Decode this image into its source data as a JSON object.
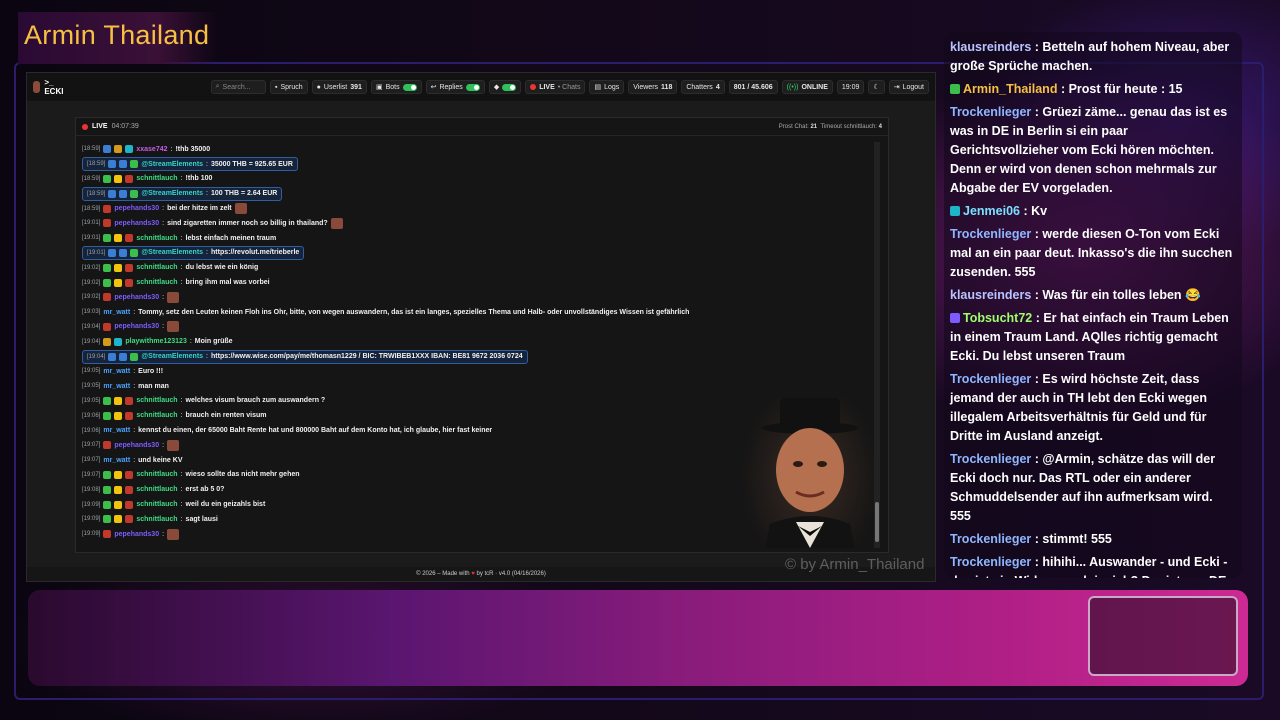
{
  "stream": {
    "title": "Armin Thailand",
    "watermark": "© by Armin_Thailand"
  },
  "topbar": {
    "brand": ">_ ECKI",
    "search_placeholder": "Search...",
    "spruch": "Spruch",
    "userlist_label": "Userlist",
    "userlist_count": "391",
    "bots": "Bots",
    "replies": "Replies",
    "live": "LIVE",
    "chats": "• Chats",
    "logs": "Logs",
    "viewers_label": "Viewers",
    "viewers_count": "118",
    "chatters_label": "Chatters",
    "chatters_count": "4",
    "ratio": "801 / 45.606",
    "online": "ONLINE",
    "clock": "19:09",
    "logout": "Logout"
  },
  "panel": {
    "live": "LIVE",
    "time": "04:07:39",
    "prost_label": "Prost Chat:",
    "prost_value": "21",
    "timeout_label": "Timeout schnittlauch:",
    "timeout_value": "4"
  },
  "chat": [
    {
      "ts": "[18:59]",
      "user": "xxase742",
      "color": "#c45ee8",
      "text": "!thb 35000",
      "bubble": false,
      "badges": [
        "b-blue",
        "b-gold",
        "b-cyan"
      ]
    },
    {
      "ts": "[18:59]",
      "user": "@StreamElements",
      "color": "#33d4c9",
      "text": "35000 THB = 925.65 EUR",
      "bubble": true,
      "badges": [
        "b-blue",
        "b-blue",
        "b-green"
      ]
    },
    {
      "ts": "[18:59]",
      "user": "schnittlauch",
      "color": "#3ddc84",
      "text": "!thb 100",
      "bubble": false,
      "badges": [
        "b-green",
        "b-yellow",
        "b-red"
      ]
    },
    {
      "ts": "[18:59]",
      "user": "@StreamElements",
      "color": "#33d4c9",
      "text": "100 THB = 2.64 EUR",
      "bubble": true,
      "badges": [
        "b-blue",
        "b-blue",
        "b-green"
      ]
    },
    {
      "ts": "[18:59]",
      "user": "pepehands30",
      "color": "#7d5cff",
      "text": "bei der hitze im zelt",
      "bubble": false,
      "badges": [
        "b-red"
      ],
      "emote": true
    },
    {
      "ts": "[19:01]",
      "user": "pepehands30",
      "color": "#7d5cff",
      "text": "sind zigaretten immer noch so billig in thailand?",
      "bubble": false,
      "badges": [
        "b-red"
      ],
      "emote": true
    },
    {
      "ts": "[19:01]",
      "user": "schnittlauch",
      "color": "#3ddc84",
      "text": "lebst einfach meinen traum",
      "bubble": false,
      "badges": [
        "b-green",
        "b-yellow",
        "b-red"
      ]
    },
    {
      "ts": "[19:01]",
      "user": "@StreamElements",
      "color": "#33d4c9",
      "text": "https://revolut.me/trieberle",
      "bubble": true,
      "badges": [
        "b-blue",
        "b-blue",
        "b-green"
      ]
    },
    {
      "ts": "[19:02]",
      "user": "schnittlauch",
      "color": "#3ddc84",
      "text": "du lebst wie ein könig",
      "bubble": false,
      "badges": [
        "b-green",
        "b-yellow",
        "b-red"
      ]
    },
    {
      "ts": "[19:02]",
      "user": "schnittlauch",
      "color": "#3ddc84",
      "text": "bring ihm mal was vorbei",
      "bubble": false,
      "badges": [
        "b-green",
        "b-yellow",
        "b-red"
      ]
    },
    {
      "ts": "[19:02]",
      "user": "pepehands30",
      "color": "#7d5cff",
      "text": "",
      "bubble": false,
      "badges": [
        "b-red"
      ],
      "emote": true
    },
    {
      "ts": "[19:03]",
      "user": "mr_watt",
      "color": "#4aa3ff",
      "text": "Tommy, setz den Leuten keinen Floh ins Ohr, bitte, von wegen auswandern, das ist ein langes, spezielles Thema und Halb- oder unvollständiges Wissen ist gefährlich",
      "bubble": false,
      "badges": []
    },
    {
      "ts": "[19:04]",
      "user": "pepehands30",
      "color": "#7d5cff",
      "text": "",
      "bubble": false,
      "badges": [
        "b-red"
      ],
      "emote": true
    },
    {
      "ts": "[19:04]",
      "user": "playwithme123123",
      "color": "#3ddc84",
      "text": "Moin grüße",
      "bubble": false,
      "badges": [
        "b-gold",
        "b-cyan"
      ]
    },
    {
      "ts": "[19:04]",
      "user": "@StreamElements",
      "color": "#33d4c9",
      "text": "https://www.wise.com/pay/me/thomasn1229 / BIC: TRWIBEB1XXX IBAN: BE81 9672 2036 0724",
      "bubble": true,
      "badges": [
        "b-blue",
        "b-blue",
        "b-green"
      ]
    },
    {
      "ts": "[19:05]",
      "user": "mr_watt",
      "color": "#4aa3ff",
      "text": "Euro !!!",
      "bubble": false,
      "badges": []
    },
    {
      "ts": "[19:05]",
      "user": "mr_watt",
      "color": "#4aa3ff",
      "text": "man man",
      "bubble": false,
      "badges": []
    },
    {
      "ts": "[19:05]",
      "user": "schnittlauch",
      "color": "#3ddc84",
      "text": "welches visum brauch zum auswandern ?",
      "bubble": false,
      "badges": [
        "b-green",
        "b-yellow",
        "b-red"
      ]
    },
    {
      "ts": "[19:06]",
      "user": "schnittlauch",
      "color": "#3ddc84",
      "text": "brauch ein renten visum",
      "bubble": false,
      "badges": [
        "b-green",
        "b-yellow",
        "b-red"
      ]
    },
    {
      "ts": "[19:06]",
      "user": "mr_watt",
      "color": "#4aa3ff",
      "text": "kennst du einen, der 65000 Baht Rente hat und 800000 Baht auf dem Konto hat, ich glaube, hier fast keiner",
      "bubble": false,
      "badges": []
    },
    {
      "ts": "[19:07]",
      "user": "pepehands30",
      "color": "#7d5cff",
      "text": "",
      "bubble": false,
      "badges": [
        "b-red"
      ],
      "emote": true
    },
    {
      "ts": "[19:07]",
      "user": "mr_watt",
      "color": "#4aa3ff",
      "text": "und keine KV",
      "bubble": false,
      "badges": []
    },
    {
      "ts": "[19:07]",
      "user": "schnittlauch",
      "color": "#3ddc84",
      "text": "wieso sollte das nicht mehr gehen",
      "bubble": false,
      "badges": [
        "b-green",
        "b-yellow",
        "b-red"
      ]
    },
    {
      "ts": "[19:08]",
      "user": "schnittlauch",
      "color": "#3ddc84",
      "text": "erst ab 5 0?",
      "bubble": false,
      "badges": [
        "b-green",
        "b-yellow",
        "b-red"
      ]
    },
    {
      "ts": "[19:09]",
      "user": "schnittlauch",
      "color": "#3ddc84",
      "text": "weil du ein geizahls bist",
      "bubble": false,
      "badges": [
        "b-green",
        "b-yellow",
        "b-red"
      ]
    },
    {
      "ts": "[19:09]",
      "user": "schnittlauch",
      "color": "#3ddc84",
      "text": "sagt lausi",
      "bubble": false,
      "badges": [
        "b-green",
        "b-yellow",
        "b-red"
      ]
    },
    {
      "ts": "[19:09]",
      "user": "pepehands30",
      "color": "#7d5cff",
      "text": "",
      "bubble": false,
      "badges": [
        "b-red"
      ],
      "emote": true
    }
  ],
  "footer": {
    "pre": "© 2026 – Made with",
    "post": "by tcR · v4.0 (04/16/2026)"
  },
  "side_chat": [
    {
      "user": "klausreinders",
      "color": "#b9c4ff",
      "text": "Betteln auf hohem Niveau, aber große Sprüche machen.",
      "icon": ""
    },
    {
      "user": "Armin_Thailand",
      "color": "#f6c044",
      "text": "Prost für heute : 15",
      "icon": "#3bbf4a"
    },
    {
      "user": "Trockenlieger",
      "color": "#8fb7ff",
      "text": "Grüezi zäme... genau das ist es was in DE in Berlin si ein paar Gerichtsvollzieher vom Ecki hören möchten. Denn er wird von denen schon mehrmals zur Abgabe der EV vorgeladen.",
      "icon": ""
    },
    {
      "user": "Jenmei06",
      "color": "#7be0ff",
      "text": "Kv",
      "icon": "#1fb5c9"
    },
    {
      "user": "Trockenlieger",
      "color": "#8fb7ff",
      "text": "werde diesen O-Ton vom Ecki mal an ein paar deut. Inkasso's die ihn succhen zusenden. 555",
      "icon": ""
    },
    {
      "user": "klausreinders",
      "color": "#b9c4ff",
      "text": "Was für ein tolles leben 😂",
      "icon": ""
    },
    {
      "user": "Tobsucht72",
      "color": "#9cff6a",
      "text": "Er hat einfach ein Traum Leben in einem Traum Land. AQlles richtig gemacht Ecki. Du lebst unseren Traum",
      "icon": "#7d5cff"
    },
    {
      "user": "Trockenlieger",
      "color": "#8fb7ff",
      "text": "Es wird höchste Zeit, dass jemand der auch in TH lebt den Ecki wegen illegalem Arbeitsverhältnis für Geld und für Dritte im Ausland anzeigt.",
      "icon": ""
    },
    {
      "user": "Trockenlieger",
      "color": "#8fb7ff",
      "text": "@Armin, schätze das will der Ecki doch nur. Das RTL oder ein anderer Schmuddelsender auf ihn aufmerksam wird. 555",
      "icon": ""
    },
    {
      "user": "Trockenlieger",
      "color": "#8fb7ff",
      "text": "stimmt! 555",
      "icon": ""
    },
    {
      "user": "Trockenlieger",
      "color": "#8fb7ff",
      "text": "hihihi... Auswander - und Ecki - das ist ein Widerspruch insich? Der ist aus DE abgehauen weil der Schuldner in DE gesucht wird.",
      "icon": ""
    }
  ]
}
